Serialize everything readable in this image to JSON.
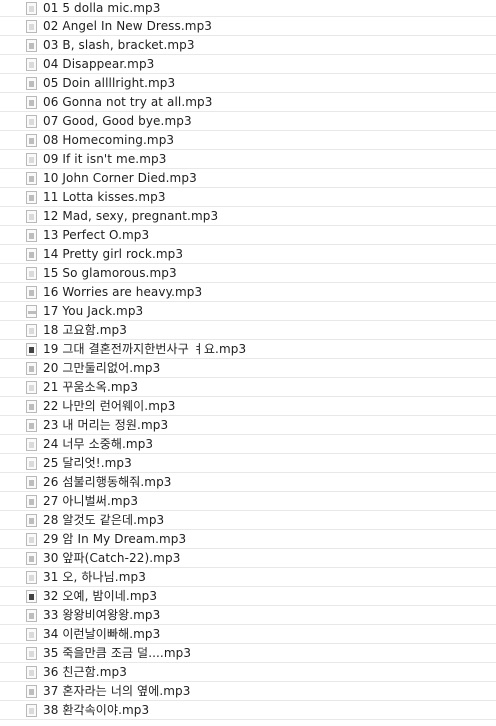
{
  "files": [
    {
      "name": "01 5 dolla mic.mp3",
      "icon": "album-art-thumbnail-icon",
      "tone": "light"
    },
    {
      "name": "02 Angel In New Dress.mp3",
      "icon": "album-art-thumbnail-icon",
      "tone": "light"
    },
    {
      "name": "03 B, slash, bracket.mp3",
      "icon": "album-art-thumbnail-icon",
      "tone": ""
    },
    {
      "name": "04 Disappear.mp3",
      "icon": "album-art-thumbnail-icon",
      "tone": "light"
    },
    {
      "name": "05 Doin allllright.mp3",
      "icon": "album-art-thumbnail-icon",
      "tone": ""
    },
    {
      "name": "06 Gonna not try at all.mp3",
      "icon": "album-art-thumbnail-icon",
      "tone": ""
    },
    {
      "name": "07 Good, Good bye.mp3",
      "icon": "album-art-thumbnail-icon",
      "tone": "light"
    },
    {
      "name": "08 Homecoming.mp3",
      "icon": "album-art-thumbnail-icon",
      "tone": ""
    },
    {
      "name": "09 If it isn't me.mp3",
      "icon": "album-art-thumbnail-icon",
      "tone": "light"
    },
    {
      "name": "10 John Corner Died.mp3",
      "icon": "album-art-thumbnail-icon",
      "tone": ""
    },
    {
      "name": "11 Lotta kisses.mp3",
      "icon": "album-art-thumbnail-icon",
      "tone": ""
    },
    {
      "name": "12 Mad, sexy, pregnant.mp3",
      "icon": "album-art-thumbnail-icon",
      "tone": "light"
    },
    {
      "name": "13 Perfect O.mp3",
      "icon": "album-art-thumbnail-icon",
      "tone": ""
    },
    {
      "name": "14 Pretty girl rock.mp3",
      "icon": "album-art-thumbnail-icon",
      "tone": ""
    },
    {
      "name": "15 So glamorous.mp3",
      "icon": "album-art-thumbnail-icon",
      "tone": "light"
    },
    {
      "name": "16 Worries are heavy.mp3",
      "icon": "album-art-thumbnail-icon",
      "tone": ""
    },
    {
      "name": "17 You Jack.mp3",
      "icon": "album-art-thumbnail-icon",
      "tone": "wide"
    },
    {
      "name": "18 고요함.mp3",
      "icon": "album-art-thumbnail-icon",
      "tone": "light"
    },
    {
      "name": "19 그대 결혼전까지한번사구 ㅕ요.mp3",
      "icon": "album-art-thumbnail-icon",
      "tone": "dark"
    },
    {
      "name": "20 그만둘리없어.mp3",
      "icon": "album-art-thumbnail-icon",
      "tone": ""
    },
    {
      "name": "21 꾸움소옥.mp3",
      "icon": "album-art-thumbnail-icon",
      "tone": "light"
    },
    {
      "name": "22 나만의 런어웨이.mp3",
      "icon": "album-art-thumbnail-icon",
      "tone": ""
    },
    {
      "name": "23 내 머리는 정원.mp3",
      "icon": "album-art-thumbnail-icon",
      "tone": ""
    },
    {
      "name": "24 너무 소중해.mp3",
      "icon": "album-art-thumbnail-icon",
      "tone": "light"
    },
    {
      "name": "25 달리엇!.mp3",
      "icon": "album-art-thumbnail-icon",
      "tone": "light"
    },
    {
      "name": "26 섬불리행동해줘.mp3",
      "icon": "album-art-thumbnail-icon",
      "tone": ""
    },
    {
      "name": "27 아니벌써.mp3",
      "icon": "album-art-thumbnail-icon",
      "tone": ""
    },
    {
      "name": "28 알것도 같은데.mp3",
      "icon": "album-art-thumbnail-icon",
      "tone": ""
    },
    {
      "name": "29 암 In My Dream.mp3",
      "icon": "album-art-thumbnail-icon",
      "tone": "light"
    },
    {
      "name": "30 앞파(Catch-22).mp3",
      "icon": "album-art-thumbnail-icon",
      "tone": ""
    },
    {
      "name": "31 오, 하나님.mp3",
      "icon": "album-art-thumbnail-icon",
      "tone": "light"
    },
    {
      "name": "32 오예, 밤이네.mp3",
      "icon": "album-art-thumbnail-icon",
      "tone": "dark"
    },
    {
      "name": "33 왕왕비여왕왕.mp3",
      "icon": "album-art-thumbnail-icon",
      "tone": ""
    },
    {
      "name": "34 이런날이빠해.mp3",
      "icon": "album-art-thumbnail-icon",
      "tone": "light"
    },
    {
      "name": "35 죽을만큼 조금 덜....mp3",
      "icon": "album-art-thumbnail-icon",
      "tone": "light"
    },
    {
      "name": "36 친근함.mp3",
      "icon": "album-art-thumbnail-icon",
      "tone": "light"
    },
    {
      "name": "37 혼자라는 너의 옆에.mp3",
      "icon": "album-art-thumbnail-icon",
      "tone": ""
    },
    {
      "name": "38 환각속이야.mp3",
      "icon": "album-art-thumbnail-icon",
      "tone": "light"
    }
  ]
}
